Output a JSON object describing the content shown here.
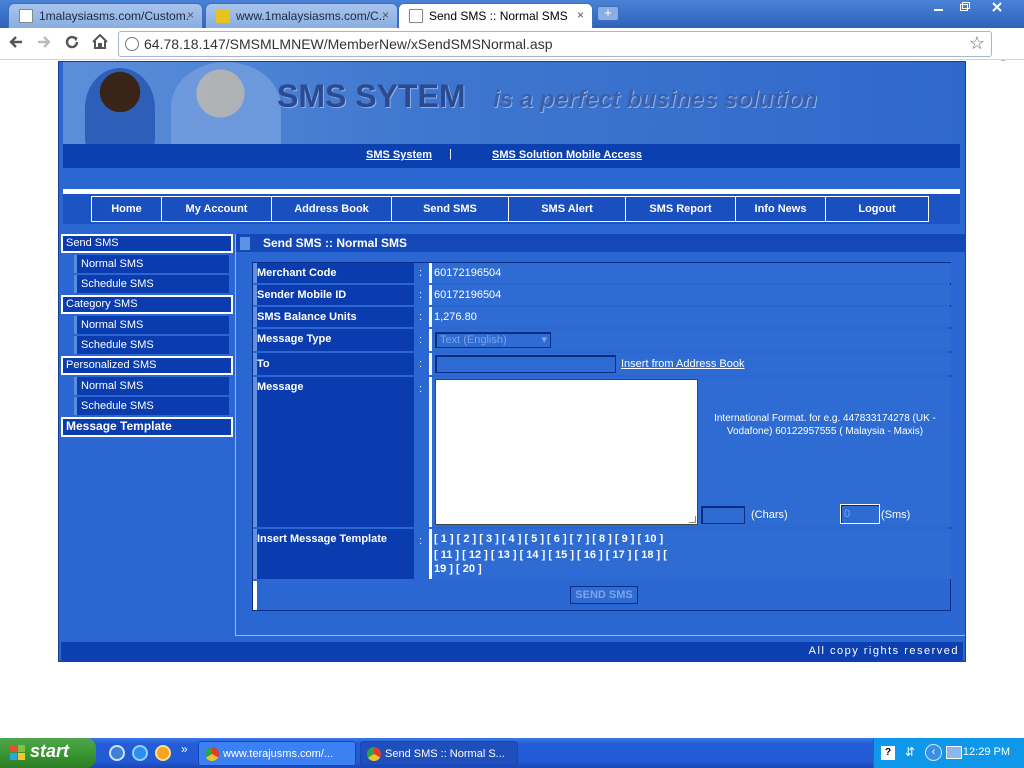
{
  "browser": {
    "tabs": [
      {
        "title": "1malaysiasms.com/Custom..."
      },
      {
        "title": "www.1malaysiasms.com/C..."
      },
      {
        "title": "Send SMS :: Normal SMS"
      }
    ],
    "url": "64.78.18.147/SMSMLMNEW/MemberNew/xSendSMSNormal.asp",
    "close_glyph": "×",
    "new_tab_glyph": "+"
  },
  "banner": {
    "title": "SMS SYTEM",
    "tagline": "is a perfect busines solution"
  },
  "top_links": {
    "sms_system": "SMS System",
    "separator": "|",
    "mobile_access": "SMS Solution Mobile Access"
  },
  "menu": [
    "Home",
    "My Account",
    "Address Book",
    "Send SMS",
    "SMS Alert",
    "SMS Report",
    "Info News",
    "Logout"
  ],
  "sidebar": {
    "send_sms": "Send SMS",
    "send_sms_normal": "Normal SMS",
    "send_sms_schedule": "Schedule SMS",
    "category_sms": "Category SMS",
    "category_normal": "Normal SMS",
    "category_schedule": "Schedule SMS",
    "personalized_sms": "Personalized SMS",
    "personalized_normal": "Normal SMS",
    "personalized_schedule": "Schedule SMS",
    "message_template": "Message Template"
  },
  "content": {
    "title": "Send SMS :: Normal SMS"
  },
  "form": {
    "colon": ":",
    "merchant_code_label": "Merchant Code",
    "merchant_code_value": "60172196504",
    "sender_mobile_label": "Sender Mobile ID",
    "sender_mobile_value": "60172196504",
    "balance_label": "SMS Balance Units",
    "balance_value": "1,276.80",
    "message_type_label": "Message Type",
    "message_type_value": "Text (English)",
    "to_label": "To",
    "to_value": "",
    "insert_address_book": "Insert from Address Book",
    "message_label": "Message",
    "message_value": "",
    "hint": "International Format. for e.g. 447833174278 (UK - Vodafone) 60122957555 ( Malaysia - Maxis)",
    "chars_value": "",
    "chars_label": "(Chars)",
    "sms_count_value": "0",
    "sms_label": "(Sms)",
    "template_label": "Insert Message Template",
    "template_line1": "[ 1 ] [ 2 ] [ 3 ] [ 4 ] [ 5 ] [ 6 ] [ 7 ] [ 8 ] [ 9 ] [ 10 ]",
    "template_line2": "[ 11 ] [ 12 ] [ 13 ] [ 14 ] [ 15 ] [ 16 ] [ 17 ] [ 18 ] [",
    "template_line3": "19 ] [ 20 ]",
    "send_button": "SEND SMS"
  },
  "footer": {
    "text": "All copy rights reserved"
  },
  "taskbar": {
    "start": "start",
    "tasks": [
      {
        "title": "www.terajusms.com/..."
      },
      {
        "title": "Send SMS :: Normal S..."
      }
    ],
    "clock": "12:29 PM"
  },
  "colors": {
    "site_blue": "#2a67d2",
    "dark_blue": "#0a3cb0",
    "taskbar_blue": "#245cd8",
    "start_green": "#37932f"
  }
}
